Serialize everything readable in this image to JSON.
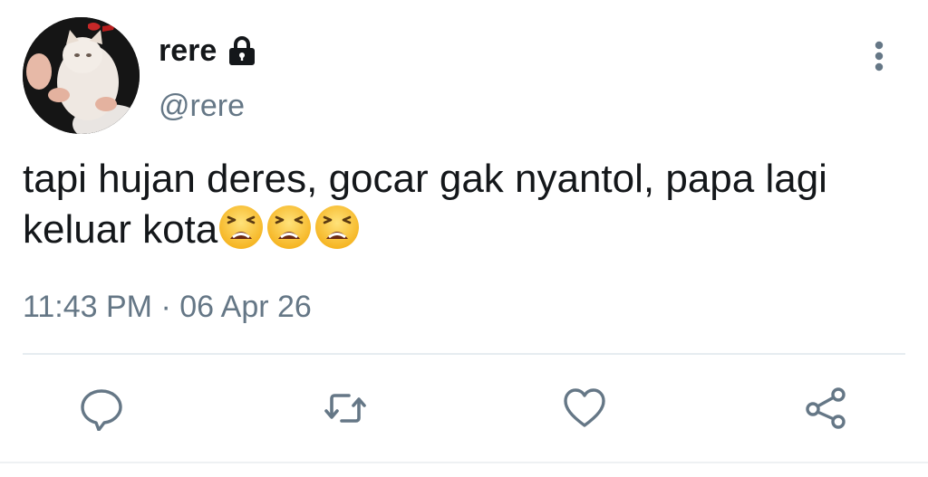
{
  "tweet": {
    "display_name": "rere",
    "handle": "@rere",
    "text": "tapi hujan deres, gocar gak nyantol, papa lagi keluar kota",
    "emojis": [
      "tired-face",
      "tired-face",
      "tired-face"
    ],
    "time": "11:43 PM",
    "separator": "·",
    "date": "06 Apr 26"
  },
  "icons": {
    "protected": "lock-icon",
    "more": "more-vertical-icon",
    "reply": "reply-icon",
    "retweet": "retweet-icon",
    "like": "heart-icon",
    "share": "share-icon"
  },
  "colors": {
    "text": "#14171a",
    "secondary": "#657786",
    "divider": "#e6ecf0"
  }
}
